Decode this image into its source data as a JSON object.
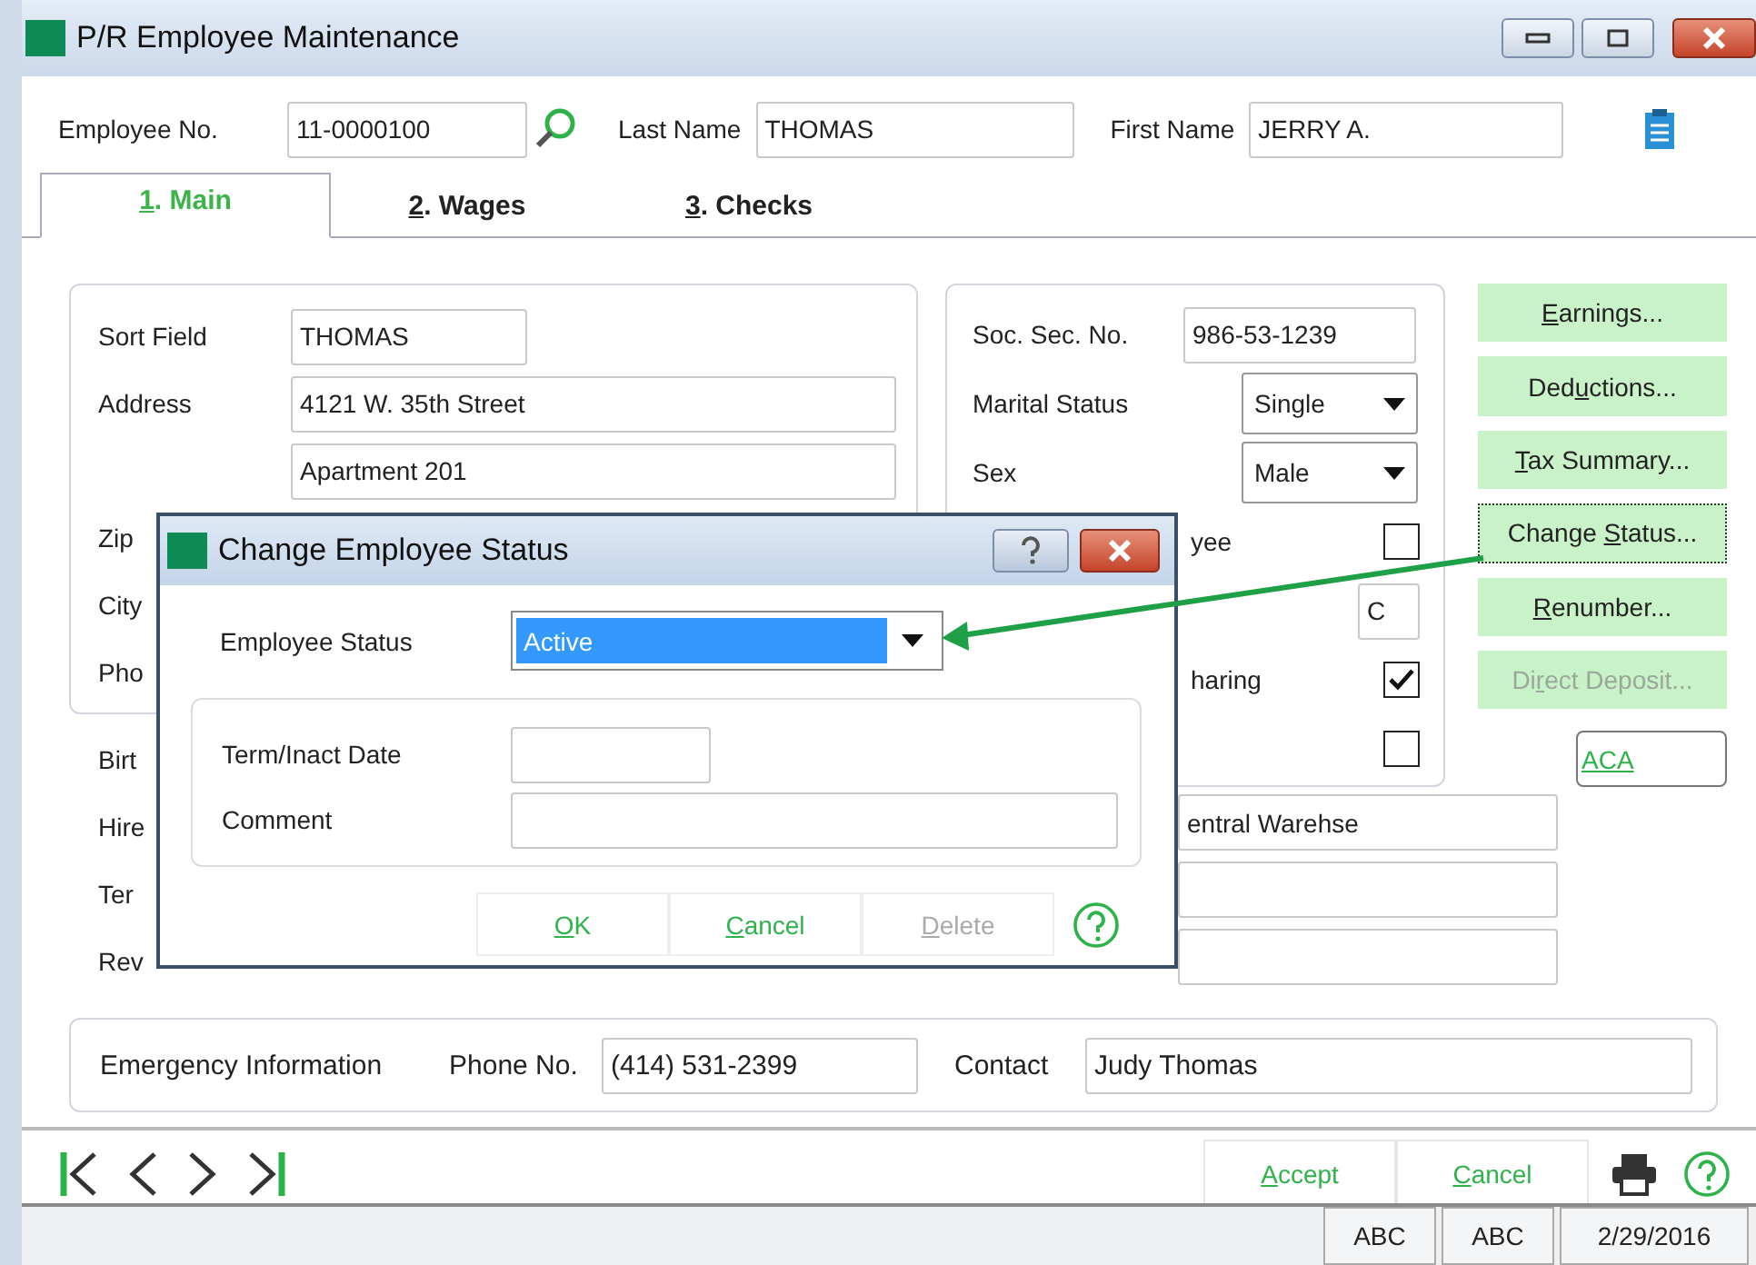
{
  "window": {
    "title": "P/R Employee Maintenance"
  },
  "header": {
    "employee_no": {
      "label": "Employee No.",
      "value": "11-0000100"
    },
    "last_name": {
      "label": "Last Name",
      "value": "THOMAS"
    },
    "first_name": {
      "label": "First Name",
      "value": "JERRY A."
    }
  },
  "tabs": [
    {
      "key": "1",
      "post": ".  Main",
      "selected": true
    },
    {
      "key": "2",
      "post": ".  Wages",
      "selected": false
    },
    {
      "key": "3",
      "post": ".  Checks",
      "selected": false
    }
  ],
  "left_group": {
    "sort_field": {
      "label": "Sort Field",
      "value": "THOMAS"
    },
    "address": {
      "label": "Address",
      "line1": "4121 W. 35th Street",
      "line2": "Apartment 201"
    },
    "hidden_labels": [
      "Zip",
      "City",
      "Pho"
    ]
  },
  "right_group": {
    "ssn": {
      "label": "Soc. Sec. No.",
      "value": "986-53-1239"
    },
    "selects": [
      {
        "label": "Marital Status",
        "value": "Single"
      },
      {
        "label": "Sex",
        "value": "Male"
      }
    ],
    "rows": [
      {
        "kind": "checkbox",
        "label": "yee",
        "checked": false
      },
      {
        "kind": "field",
        "value": "C"
      },
      {
        "kind": "checkbox",
        "label": "haring",
        "checked": true
      },
      {
        "kind": "checkbox",
        "checked": false
      }
    ]
  },
  "lower_labels": [
    "Birt",
    "Hire",
    "Ter",
    "Rev"
  ],
  "lower_fields": [
    {
      "kind": "text",
      "value": "entral Warehse"
    },
    {
      "kind": "blank"
    },
    {
      "kind": "blank"
    }
  ],
  "side_buttons": [
    {
      "key": "E",
      "post": "arnings...",
      "disabled": false,
      "focused": false
    },
    {
      "pre": "Ded",
      "key": "u",
      "post": "ctions...",
      "disabled": false,
      "focused": false
    },
    {
      "key": "T",
      "post": "ax Summary...",
      "disabled": false,
      "focused": false
    },
    {
      "pre": "Change ",
      "key": "S",
      "post": "tatus...",
      "disabled": false,
      "focused": true
    },
    {
      "key": "R",
      "post": "enumber...",
      "disabled": false,
      "focused": false
    },
    {
      "pre": "Di",
      "key": "r",
      "post": "ect Deposit...",
      "disabled": true,
      "focused": false
    }
  ],
  "aca_link": "ACA",
  "emergency": {
    "title": "Emergency Information",
    "phone": {
      "label": "Phone No.",
      "value": "(414) 531-2399"
    },
    "contact": {
      "label": "Contact",
      "value": "Judy Thomas"
    }
  },
  "actions": [
    {
      "key": "A",
      "post": "ccept"
    },
    {
      "key": "C",
      "post": "ancel"
    }
  ],
  "status_bar": [
    "ABC",
    "ABC",
    "2/29/2016"
  ],
  "dialog": {
    "title": "Change Employee Status",
    "status": {
      "label": "Employee Status",
      "value": "Active"
    },
    "term_date": {
      "label": "Term/Inact Date"
    },
    "comment": {
      "label": "Comment"
    },
    "buttons": [
      {
        "key": "O",
        "post": "K",
        "disabled": false
      },
      {
        "key": "C",
        "post": "ancel",
        "disabled": false
      },
      {
        "key": "D",
        "post": "elete",
        "disabled": true
      }
    ]
  }
}
